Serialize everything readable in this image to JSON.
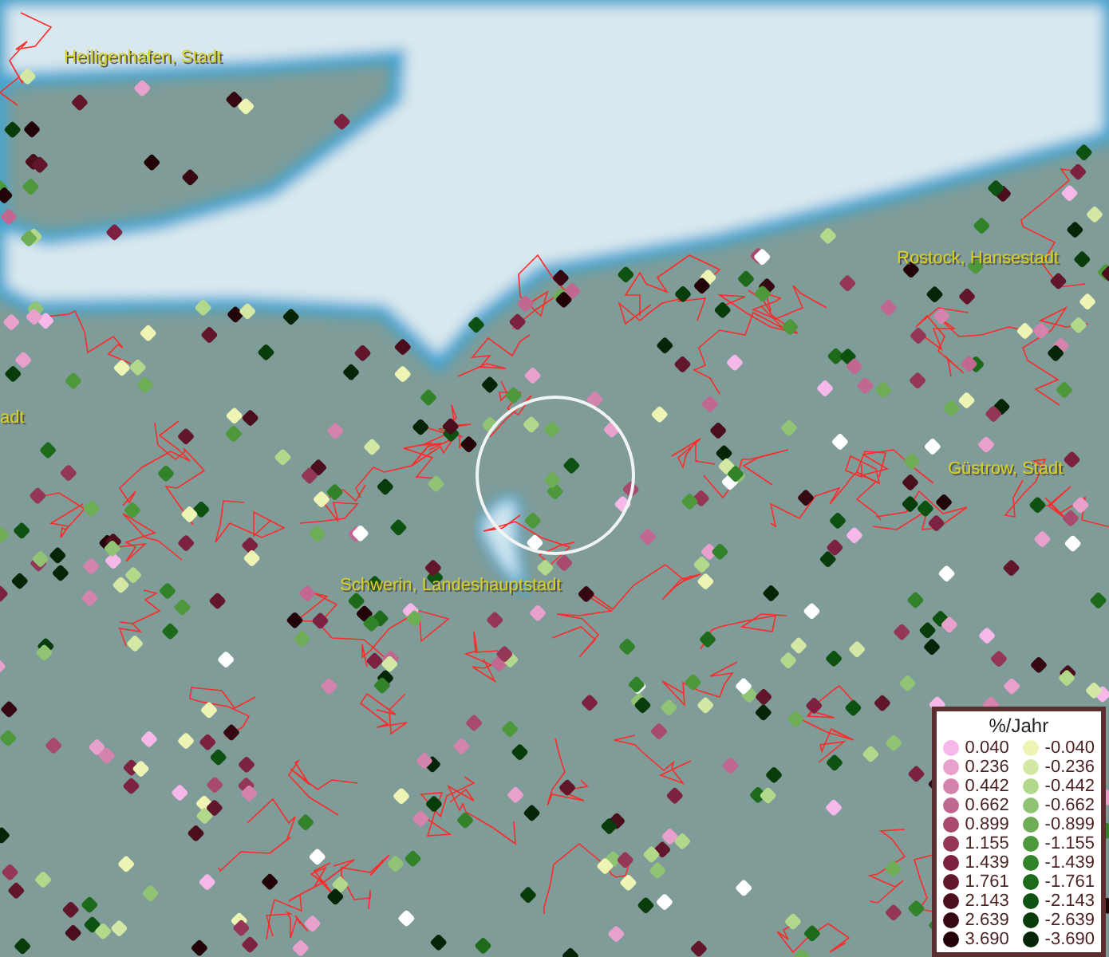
{
  "map": {
    "place_labels": [
      {
        "text": "Heiligenhafen, Stadt"
      },
      {
        "text": "Rostock, Hansestadt"
      },
      {
        "text": "adt"
      },
      {
        "text": "Güstrow, Stadt"
      },
      {
        "text": "Schwerin, Landeshauptstadt"
      }
    ]
  },
  "legend": {
    "title": "%/Jahr",
    "rows": [
      {
        "positive": {
          "label": "0.040",
          "color": "#f6b8e8"
        },
        "negative": {
          "label": "-0.040",
          "color": "#eef5b4"
        }
      },
      {
        "positive": {
          "label": "0.236",
          "color": "#e8a0cc"
        },
        "negative": {
          "label": "-0.236",
          "color": "#d2e8a4"
        }
      },
      {
        "positive": {
          "label": "0.442",
          "color": "#d484ac"
        },
        "negative": {
          "label": "-0.442",
          "color": "#b2d88c"
        }
      },
      {
        "positive": {
          "label": "0.662",
          "color": "#c06890"
        },
        "negative": {
          "label": "-0.662",
          "color": "#90c474"
        }
      },
      {
        "positive": {
          "label": "0.899",
          "color": "#a84a70"
        },
        "negative": {
          "label": "-0.899",
          "color": "#6eac56"
        }
      },
      {
        "positive": {
          "label": "1.155",
          "color": "#943656"
        },
        "negative": {
          "label": "-1.155",
          "color": "#4e983c"
        }
      },
      {
        "positive": {
          "label": "1.439",
          "color": "#7c2240"
        },
        "negative": {
          "label": "-1.439",
          "color": "#32822a"
        }
      },
      {
        "positive": {
          "label": "1.761",
          "color": "#62162c"
        },
        "negative": {
          "label": "-1.761",
          "color": "#1c6a1a"
        }
      },
      {
        "positive": {
          "label": "2.143",
          "color": "#4a0e1c"
        },
        "negative": {
          "label": "-2.143",
          "color": "#0e5212"
        }
      },
      {
        "positive": {
          "label": "2.639",
          "color": "#360812"
        },
        "negative": {
          "label": "-2.639",
          "color": "#083c0a"
        }
      },
      {
        "positive": {
          "label": "3.690",
          "color": "#220408"
        },
        "negative": {
          "label": "-3.690",
          "color": "#042606"
        }
      }
    ]
  }
}
